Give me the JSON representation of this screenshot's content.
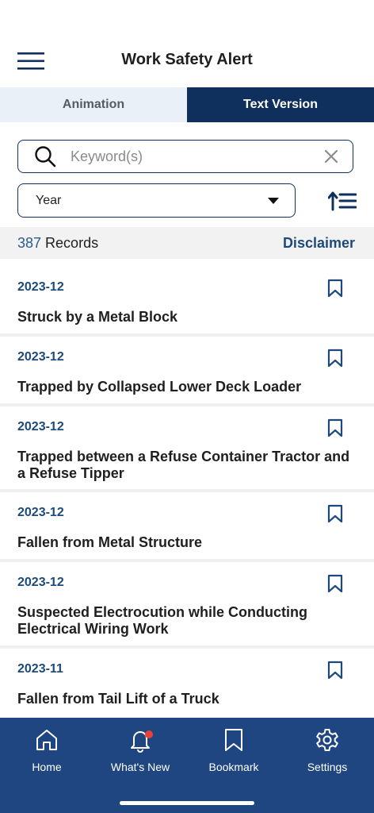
{
  "header": {
    "title": "Work Safety Alert"
  },
  "tabs": [
    {
      "label": "Animation",
      "active": false
    },
    {
      "label": "Text Version",
      "active": true
    }
  ],
  "search": {
    "placeholder": "Keyword(s)",
    "value": ""
  },
  "filter": {
    "year_label": "Year"
  },
  "records": {
    "count": "387",
    "suffix": " Records",
    "disclaimer": "Disclaimer"
  },
  "items": [
    {
      "date": "2023-12",
      "title": "Struck by a Metal Block"
    },
    {
      "date": "2023-12",
      "title": "Trapped by Collapsed Lower Deck Loader"
    },
    {
      "date": "2023-12",
      "title": "Trapped between a Refuse Container Tractor and a Refuse Tipper"
    },
    {
      "date": "2023-12",
      "title": "Fallen from Metal Structure"
    },
    {
      "date": "2023-12",
      "title": "Suspected Electrocution while Conducting Electrical Wiring Work"
    },
    {
      "date": "2023-11",
      "title": "Fallen from Tail Lift of a Truck"
    }
  ],
  "nav": [
    {
      "label": "Home",
      "icon": "home-icon"
    },
    {
      "label": "What's New",
      "icon": "bell-icon"
    },
    {
      "label": "Bookmark",
      "icon": "bookmark-icon"
    },
    {
      "label": "Settings",
      "icon": "gear-icon"
    }
  ],
  "colors": {
    "primary": "#0f2f5c",
    "nav_bg": "#1f4680",
    "accent_text": "#1e4a7a",
    "badge": "#e8413a"
  }
}
